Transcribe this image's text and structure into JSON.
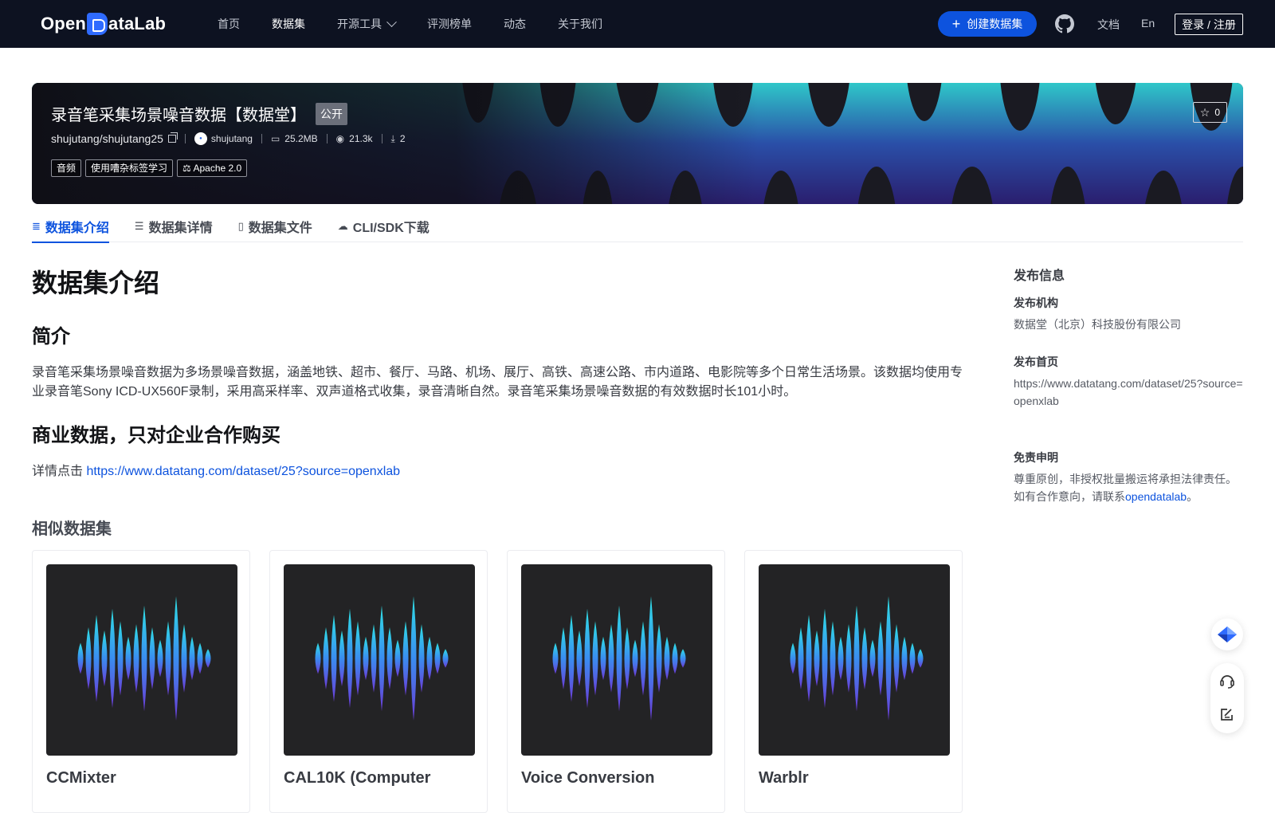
{
  "nav": {
    "logo_left": "Open",
    "logo_right": "ataLab",
    "links": [
      "首页",
      "数据集",
      "开源工具",
      "评测榜单",
      "动态",
      "关于我们"
    ],
    "create_label": "创建数据集",
    "docs": "文档",
    "lang": "En",
    "login": "登录 / 注册"
  },
  "dataset": {
    "title": "录音笔采集场景噪音数据【数据堂】",
    "visibility": "公开",
    "stars": "0",
    "repo": "shujutang/shujutang25",
    "owner": "shujutang",
    "size": "25.2MB",
    "views": "21.3k",
    "downloads": "2",
    "tags": [
      "音频",
      "使用嘈杂标签学习"
    ],
    "license": "Apache 2.0"
  },
  "tabs": [
    "数据集介绍",
    "数据集详情",
    "数据集文件",
    "CLI/SDK下载"
  ],
  "content": {
    "heading": "数据集介绍",
    "intro_heading": "简介",
    "intro_text": "录音笔采集场景噪音数据为多场景噪音数据，涵盖地铁、超市、餐厅、马路、机场、展厅、高铁、高速公路、市内道路、电影院等多个日常生活场景。该数据均使用专业录音笔Sony ICD-UX560F录制，采用高采样率、双声道格式收集，录音清晰自然。录音笔采集场景噪音数据的有效数据时长101小时。",
    "commercial_heading": "商业数据，只对企业合作购买",
    "detail_prefix": "详情点击 ",
    "detail_link": "https://www.datatang.com/dataset/25?source=openxlab",
    "similar_heading": "相似数据集",
    "similar": [
      "CCMixter",
      "CAL10K (Computer",
      "Voice Conversion",
      "Warblr"
    ]
  },
  "sidebar": {
    "title": "发布信息",
    "org_label": "发布机构",
    "org": "数据堂（北京）科技股份有限公司",
    "home_label": "发布首页",
    "home": "https://www.datatang.com/dataset/25?source=openxlab",
    "disclaimer_label": "免责申明",
    "disclaimer_prefix": "尊重原创，非授权批量搬运将承担法律责任。如有合作意向，请联系",
    "disclaimer_link": "opendatalab",
    "disclaimer_suffix": "。"
  },
  "colors": {
    "nav_bg": "#0d1221",
    "accent": "#0d53de"
  }
}
